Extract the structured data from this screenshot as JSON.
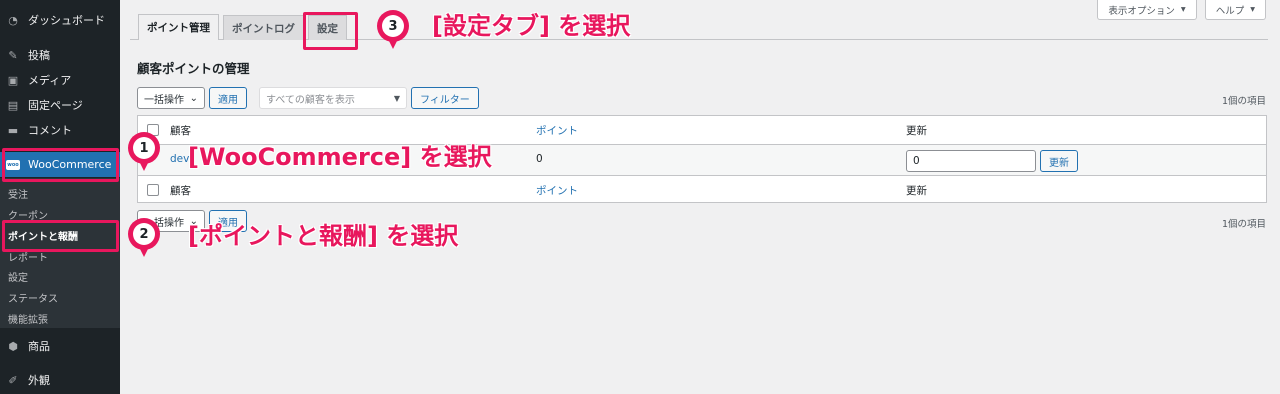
{
  "sidebar": {
    "dashboard": "ダッシュボード",
    "posts": "投稿",
    "media": "メディア",
    "pages": "固定ページ",
    "comments": "コメント",
    "woocommerce": "WooCommerce",
    "submenu": [
      "受注",
      "クーポン",
      "ポイントと報酬",
      "レポート",
      "設定",
      "ステータス",
      "機能拡張"
    ],
    "products": "商品",
    "appearance": "外観"
  },
  "screen_meta": {
    "screen_options": "表示オプション",
    "help": "ヘルプ"
  },
  "tabs": [
    "ポイント管理",
    "ポイントログ",
    "設定"
  ],
  "page_title": "顧客ポイントの管理",
  "top_nav": {
    "bulk_action": "一括操作",
    "apply": "適用",
    "customer_filter_placeholder": "すべての顧客を表示",
    "filter": "フィルター",
    "item_count": "1個の項目"
  },
  "table": {
    "headers": [
      "顧客",
      "ポイント",
      "更新"
    ],
    "rows": [
      {
        "customer": "dev",
        "points": "0",
        "update_value": "0",
        "update_button": "更新"
      }
    ]
  },
  "bottom_nav": {
    "bulk_action": "一括操作",
    "apply": "適用",
    "item_count": "1個の項目"
  },
  "annotations": {
    "step1": {
      "number": "1",
      "text": "[WooCommerce] を選択"
    },
    "step2": {
      "number": "2",
      "text": "[ポイントと報酬] を選択"
    },
    "step3": {
      "number": "3",
      "text": "[設定タブ] を選択"
    },
    "color": "#e8175d"
  },
  "colors": {
    "sidebar_bg": "#1d2327",
    "accent": "#2271b1"
  }
}
